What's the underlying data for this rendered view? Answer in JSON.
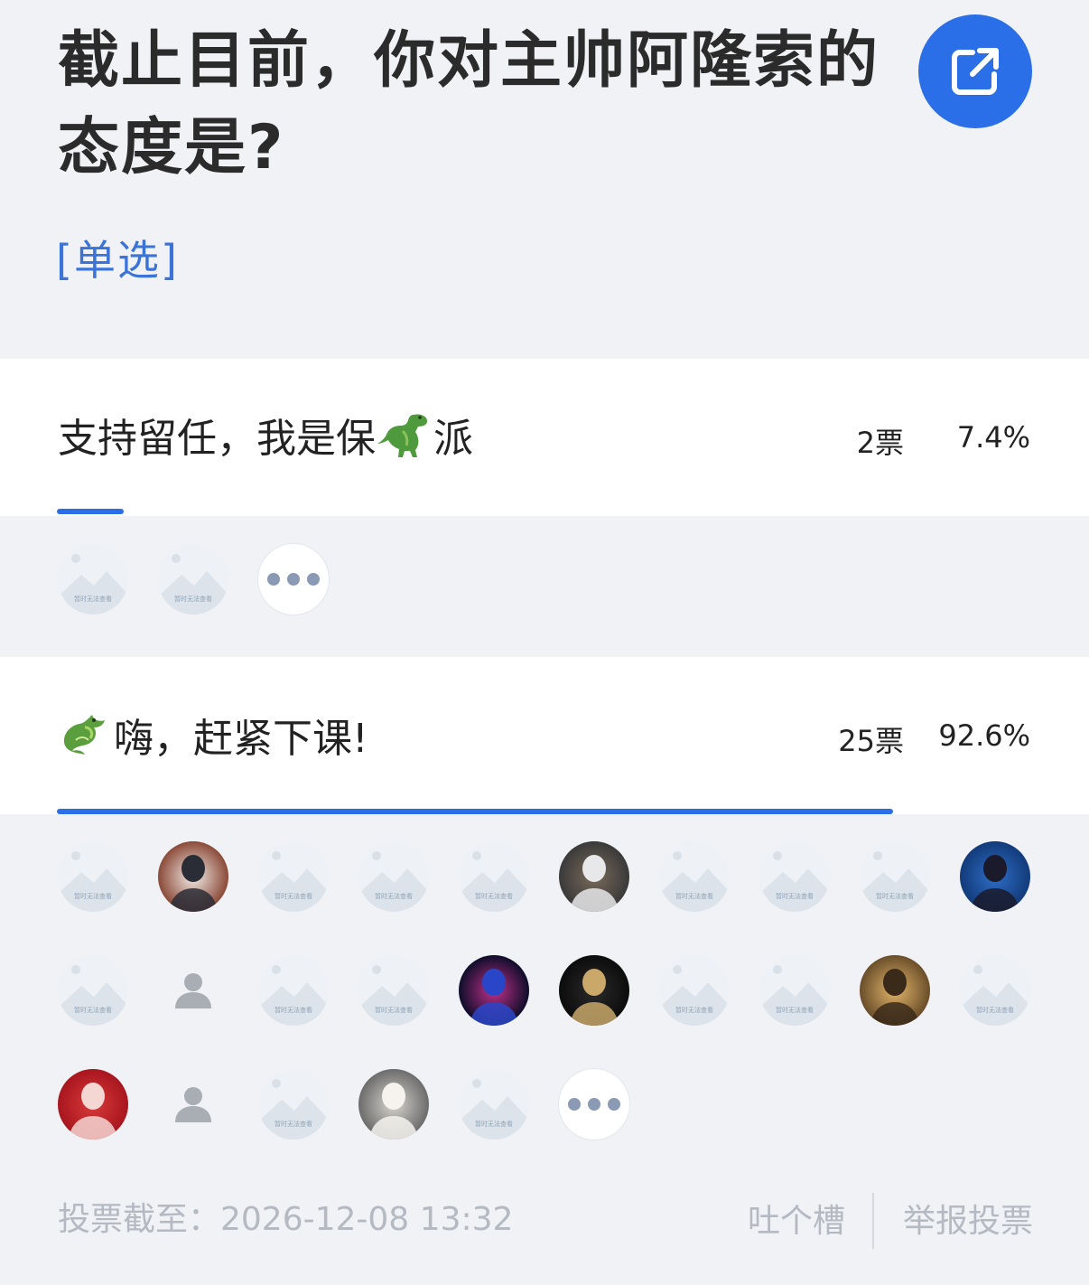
{
  "header": {
    "title": "截止目前，你对主帅阿隆索的态度是?",
    "vote_type": "[单选]",
    "share_icon": "external-link-icon"
  },
  "options": [
    {
      "label_before": "支持留任，我是保",
      "emoji": "dinosaur-emoji",
      "label_after": "派",
      "votes": "2票",
      "percent": "7.4%",
      "fill": 0.074
    },
    {
      "emoji": "dragon-emoji",
      "label_after": "嗨，赶紧下课!",
      "votes": "25票",
      "percent": "92.6%",
      "fill": 0.926
    }
  ],
  "placeholder_text": "暂时无法查看",
  "footer": {
    "deadline": "投票截至：2026-12-08 13:32",
    "complain": "吐个槽",
    "report": "举报投票"
  },
  "colors": {
    "accent": "#2a6fe8",
    "background": "#f1f2f6",
    "muted_text": "#b4b9c2"
  }
}
